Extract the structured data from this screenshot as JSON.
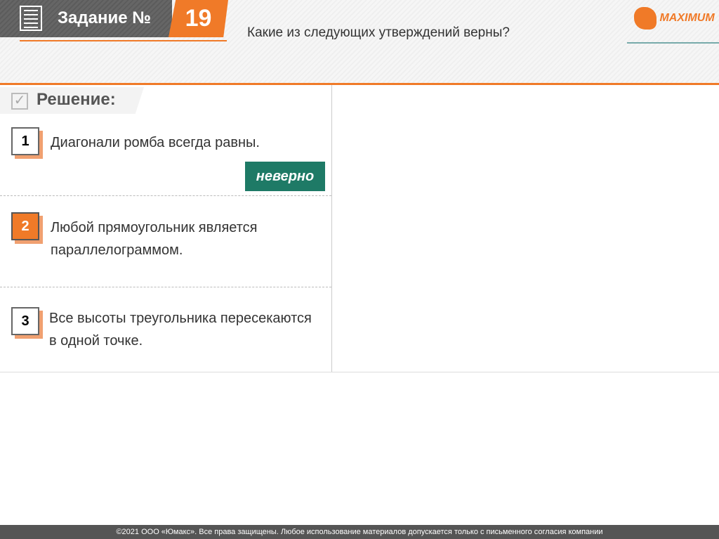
{
  "header": {
    "task_label": "Задание №",
    "task_number": "19",
    "question": "Какие из следующих утверждений верны?",
    "logo_text": "MAXIMUM"
  },
  "solution": {
    "label": "Решение:"
  },
  "items": [
    {
      "number": "1",
      "text": "Диагонали ромба всегда равны.",
      "verdict": "неверно"
    },
    {
      "number": "2",
      "text": "Любой прямоугольник является параллелограммом."
    },
    {
      "number": "3",
      "text": "Все высоты треугольника пересекаются в одной точке."
    }
  ],
  "footer": {
    "text": "©2021 ООО «Юмакс». Все права защищены. Любое использование материалов допускается только с  письменного согласия компании"
  },
  "colors": {
    "accent": "#f07a28",
    "verdict": "#1e7a66"
  }
}
